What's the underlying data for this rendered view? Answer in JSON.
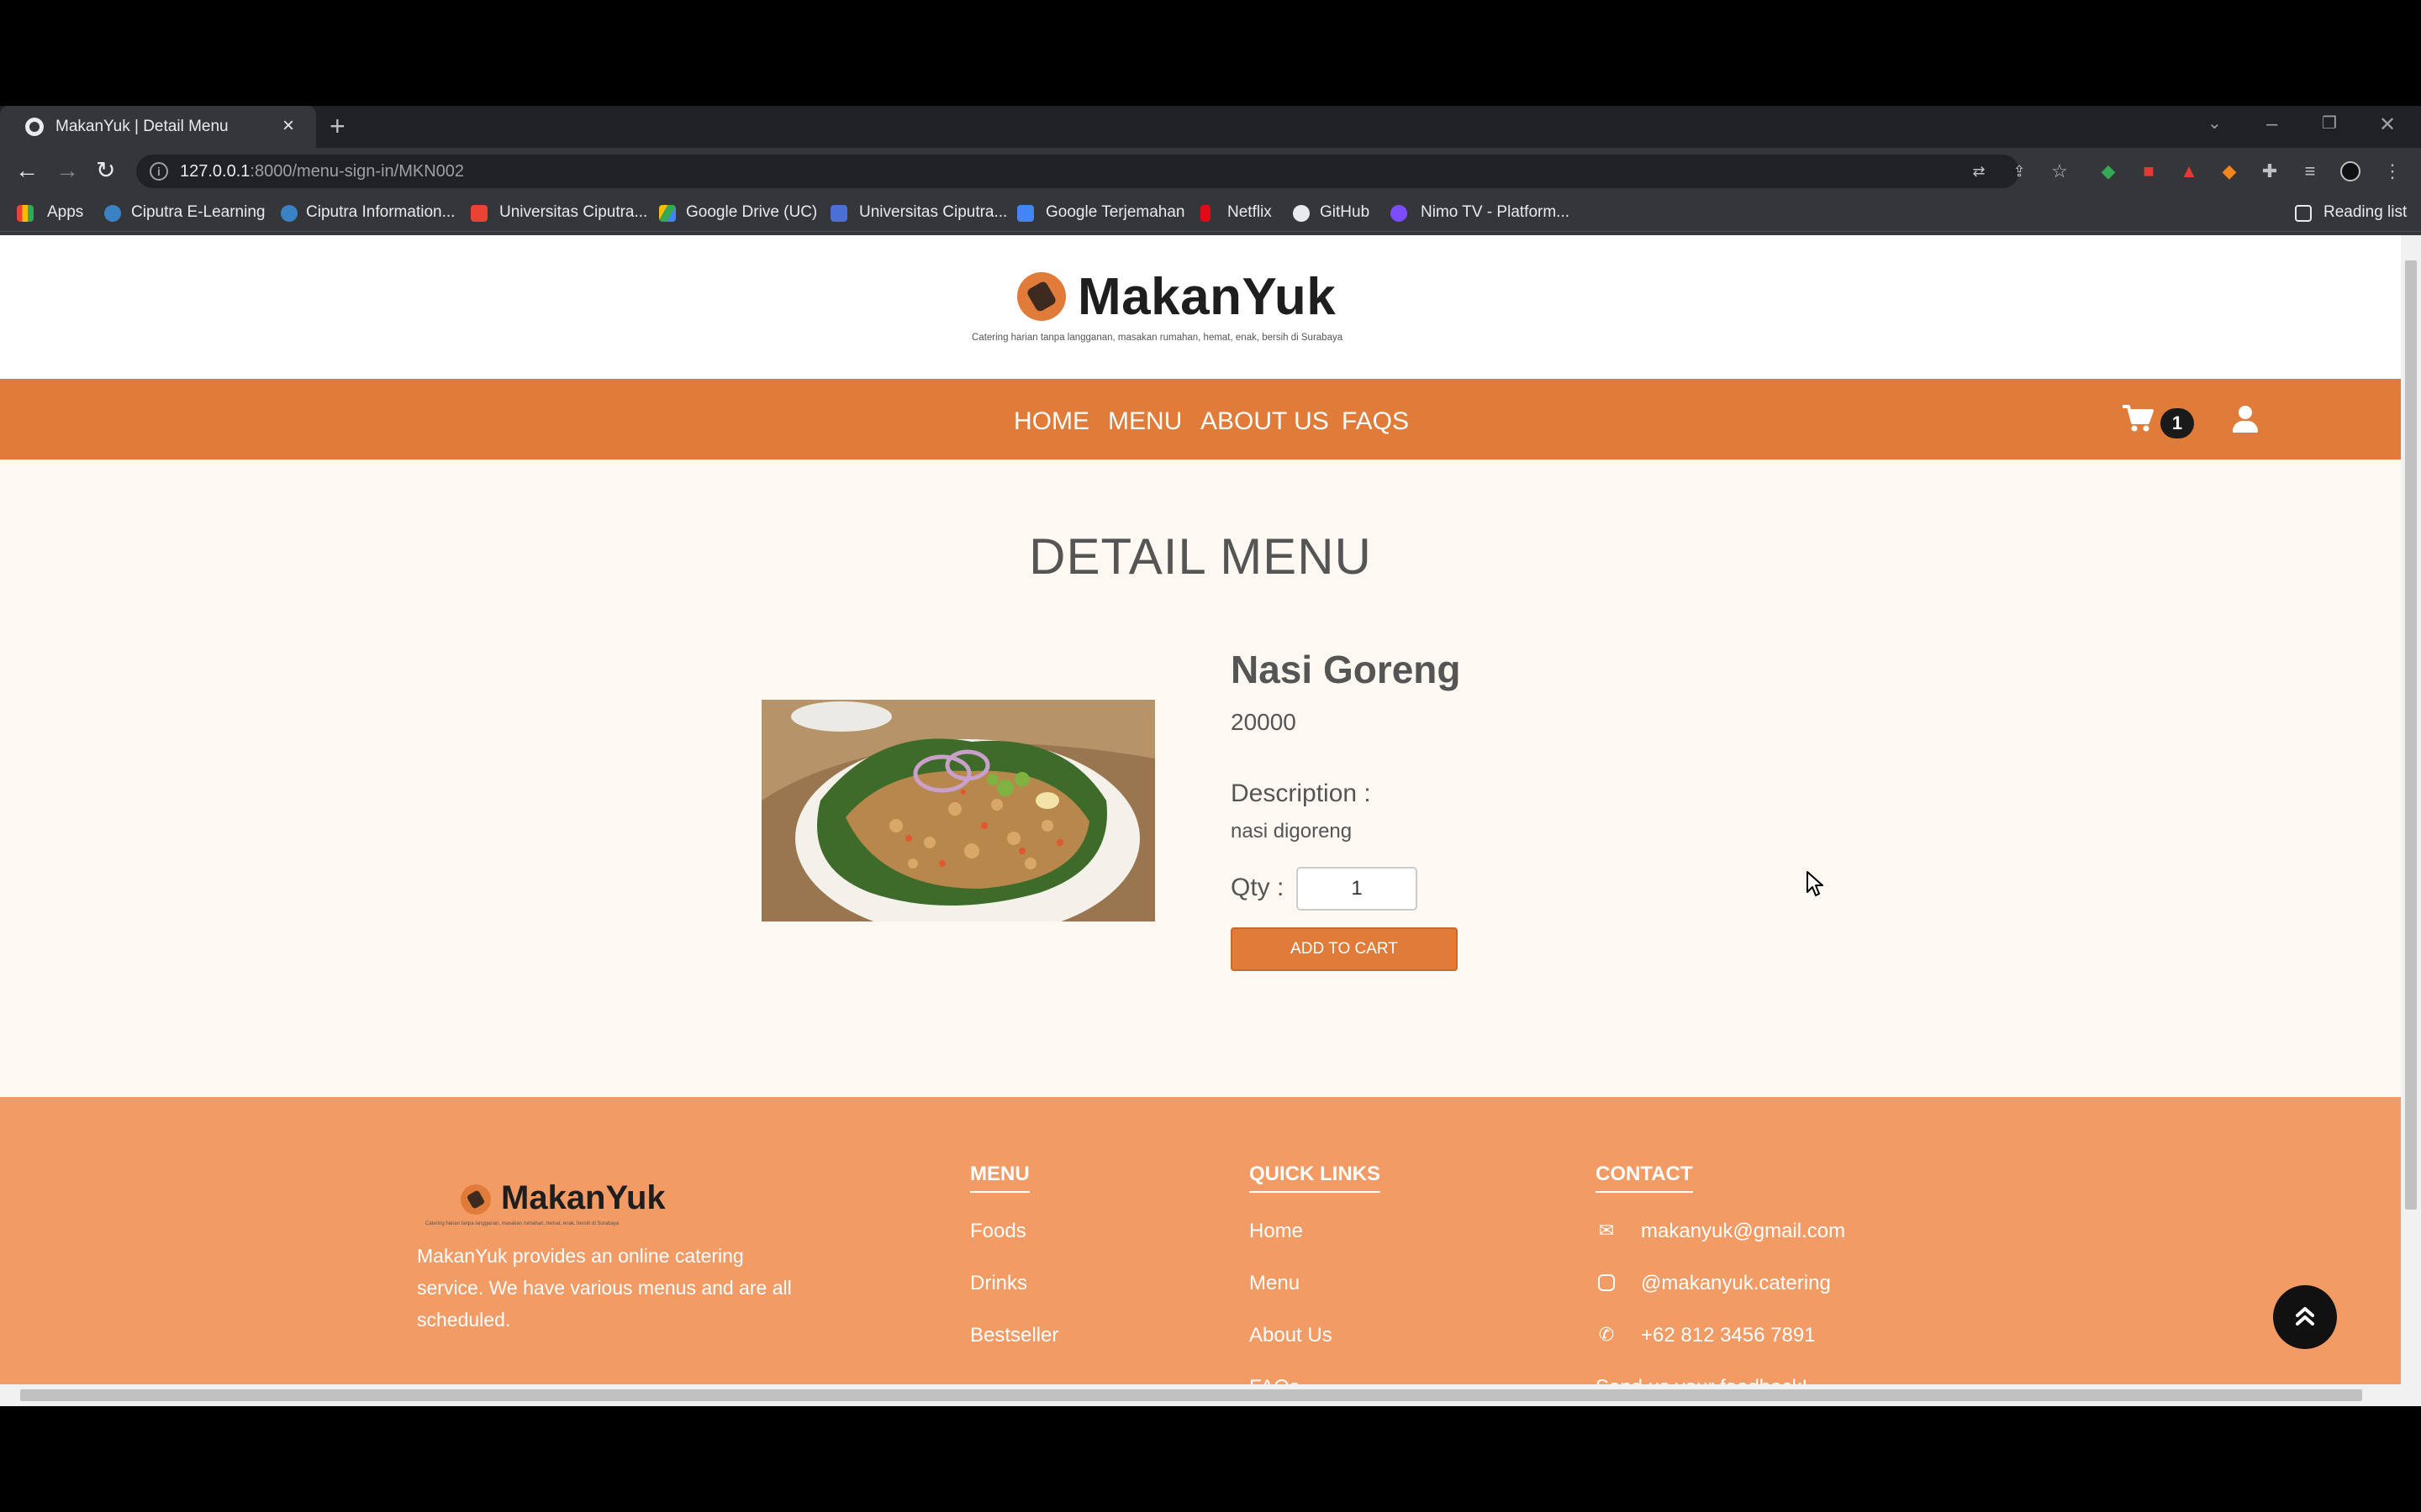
{
  "browser": {
    "tab_title": "MakanYuk | Detail Menu",
    "url_host": "127.0.0.1",
    "url_rest": ":8000/menu-sign-in/MKN002",
    "bookmarks": [
      "Apps",
      "Ciputra E-Learning",
      "Ciputra Information...",
      "Universitas Ciputra...",
      "Google Drive (UC)",
      "Universitas Ciputra...",
      "Google Terjemahan",
      "Netflix",
      "GitHub",
      "Nimo TV - Platform..."
    ],
    "reading_list": "Reading list"
  },
  "brand": {
    "name": "MakanYuk",
    "tagline": "Catering harian tanpa langganan, masakan rumahan, hemat, enak, bersih di Surabaya",
    "accent_color": "#e07b39",
    "footer_color": "#f29b65"
  },
  "nav": {
    "links": [
      "HOME",
      "MENU",
      "ABOUT US",
      "FAQS"
    ],
    "cart_count": "1",
    "icons": [
      "cart-icon",
      "user-icon"
    ]
  },
  "main": {
    "title": "DETAIL MENU",
    "product": {
      "name": "Nasi Goreng",
      "price": "20000",
      "description_label": "Description :",
      "description": "nasi digoreng",
      "qty_label": "Qty :",
      "qty_value": "1",
      "add_to_cart": "ADD TO CART"
    }
  },
  "footer": {
    "about": "MakanYuk provides an online catering service. We have various menus and are all scheduled.",
    "menu": {
      "heading": "MENU",
      "links": [
        "Foods",
        "Drinks",
        "Bestseller"
      ]
    },
    "quick_links": {
      "heading": "QUICK LINKS",
      "links": [
        "Home",
        "Menu",
        "About Us",
        "FAQs"
      ]
    },
    "contact": {
      "heading": "CONTACT",
      "email": "makanyuk@gmail.com",
      "instagram": "@makanyuk.catering",
      "phone": "+62 812 3456 7891",
      "feedback": "Send us your feedback!"
    }
  }
}
